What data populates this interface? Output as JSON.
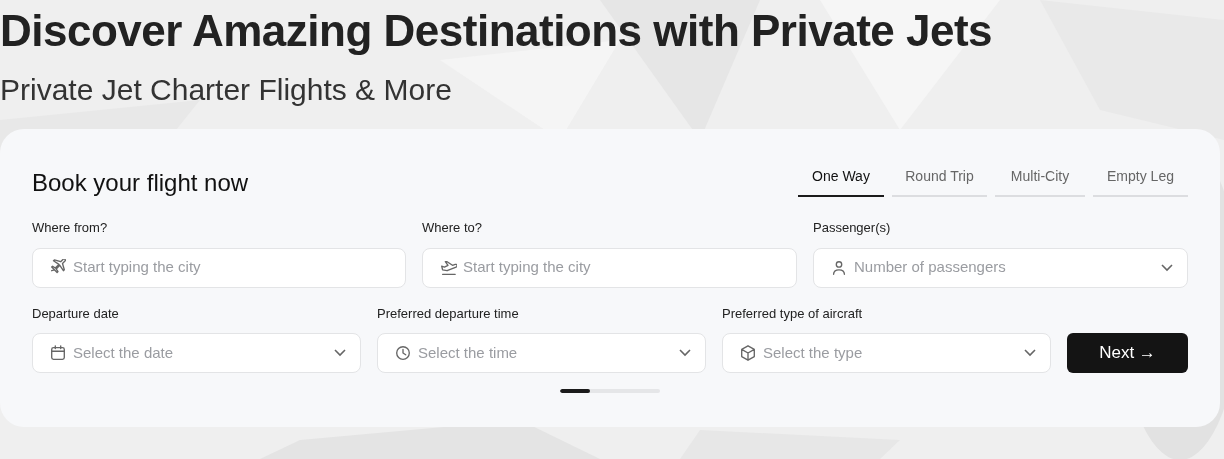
{
  "hero": {
    "title": "Discover Amazing Destinations with Private Jets",
    "subtitle": "Private Jet Charter Flights & More"
  },
  "booking": {
    "title": "Book your flight now",
    "tabs": [
      {
        "label": "One Way",
        "selected": true
      },
      {
        "label": "Round Trip",
        "selected": false
      },
      {
        "label": "Multi-City",
        "selected": false
      },
      {
        "label": "Empty Leg",
        "selected": false
      }
    ],
    "rows": [
      [
        {
          "label": "Where from?",
          "placeholder": "Start typing the city",
          "kind": "input"
        },
        {
          "label": "Where to?",
          "placeholder": "Start typing the city",
          "kind": "input"
        },
        {
          "label": "Passenger(s)",
          "placeholder": "Number of passengers",
          "kind": "select"
        }
      ],
      [
        {
          "label": "Departure date",
          "placeholder": "Select the date",
          "kind": "select"
        },
        {
          "label": "Preferred departure time",
          "placeholder": "Select the time",
          "kind": "select"
        },
        {
          "label": "Preferred type of aircraft",
          "placeholder": "Select the type",
          "kind": "select"
        }
      ]
    ],
    "next_button": "Next →",
    "progress": {
      "level": 0.3
    }
  }
}
